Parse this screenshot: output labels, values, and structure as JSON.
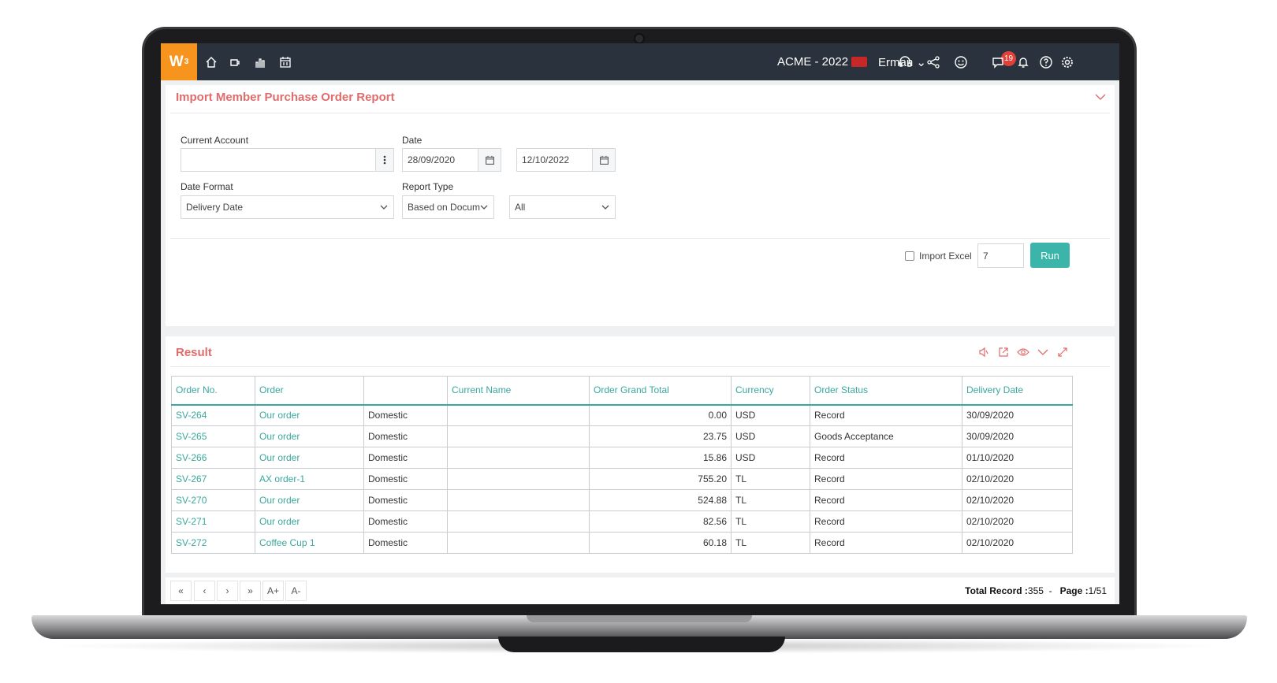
{
  "topbar": {
    "logo": "W",
    "logo_sup": "3",
    "company": "ACME - 2022",
    "user": "Erman",
    "notifications_count": "19",
    "icons": [
      "home-icon",
      "coffee-icon",
      "chart-icon",
      "calendar-icon",
      "headset-icon",
      "share-icon",
      "smiley-icon",
      "chat-icon",
      "bell-icon",
      "help-icon",
      "gear-icon"
    ]
  },
  "filter": {
    "title": "Import Member Purchase Order Report",
    "current_account_label": "Current Account",
    "current_account_value": "",
    "date_label": "Date",
    "date_from": "28/09/2020",
    "date_to": "12/10/2022",
    "date_format_label": "Date Format",
    "date_format_value": "Delivery Date",
    "report_type_label": "Report Type",
    "report_type_value": "Based on Docum",
    "report_scope_value": "All",
    "import_excel_label": "Import Excel",
    "page_size": "7",
    "run_label": "Run"
  },
  "result": {
    "title": "Result",
    "columns": [
      "Order No.",
      "Order",
      "",
      "Current Name",
      "Order Grand Total",
      "Currency",
      "Order Status",
      "Delivery Date"
    ],
    "rows": [
      [
        "SV-264",
        "Our order",
        "Domestic",
        "",
        "0.00",
        "USD",
        "Record",
        "30/09/2020"
      ],
      [
        "SV-265",
        "Our order",
        "Domestic",
        "",
        "23.75",
        "USD",
        "Goods Acceptance",
        "30/09/2020"
      ],
      [
        "SV-266",
        "Our order",
        "Domestic",
        "",
        "15.86",
        "USD",
        "Record",
        "01/10/2020"
      ],
      [
        "SV-267",
        "AX order-1",
        "Domestic",
        "",
        "755.20",
        "TL",
        "Record",
        "02/10/2020"
      ],
      [
        "SV-270",
        "Our order",
        "Domestic",
        "",
        "524.88",
        "TL",
        "Record",
        "02/10/2020"
      ],
      [
        "SV-271",
        "Our order",
        "Domestic",
        "",
        "82.56",
        "TL",
        "Record",
        "02/10/2020"
      ],
      [
        "SV-272",
        "Coffee Cup 1",
        "Domestic",
        "",
        "60.18",
        "TL",
        "Record",
        "02/10/2020"
      ]
    ]
  },
  "pager": {
    "first": "«",
    "prev": "‹",
    "next": "›",
    "last": "»",
    "font_up": "A+",
    "font_down": "A-",
    "total_label": "Total Record :",
    "total_value": "355",
    "sep": "-",
    "page_label": "Page :",
    "page_value": "1/51"
  },
  "colors": {
    "brand": "#f7941d",
    "accent": "#3bb5a9",
    "title": "#e06c6c",
    "topbar": "#2a333d"
  }
}
